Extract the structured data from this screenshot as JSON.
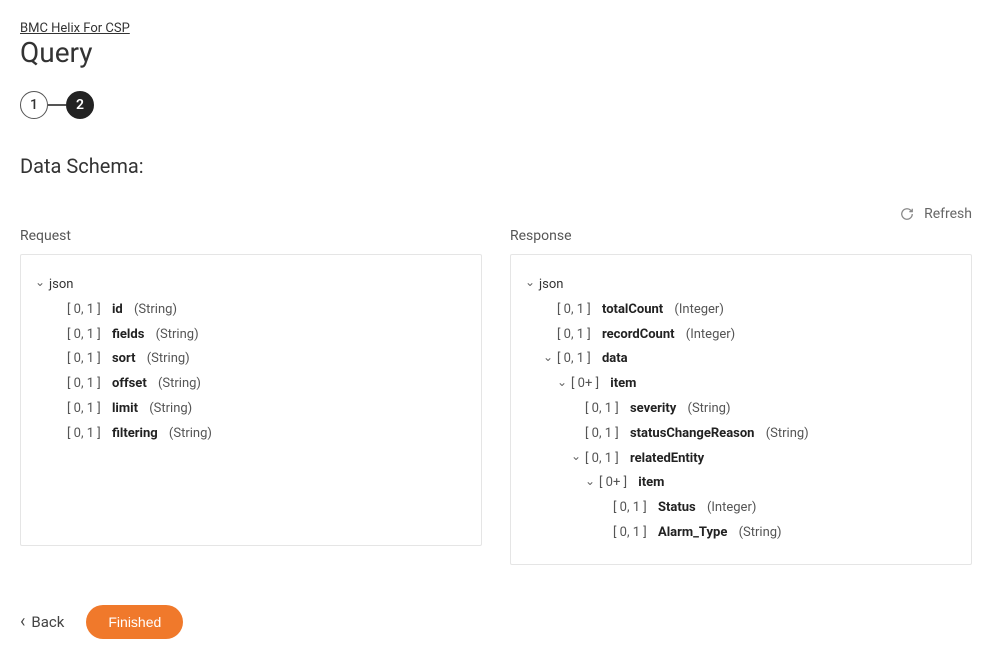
{
  "breadcrumb": "BMC Helix For CSP",
  "page_title": "Query",
  "stepper": {
    "steps": [
      "1",
      "2"
    ],
    "active_index": 1
  },
  "section_title": "Data Schema:",
  "refresh_label": "Refresh",
  "request": {
    "label": "Request",
    "root_label": "json",
    "items": [
      {
        "card": "[ 0, 1 ]",
        "name": "id",
        "type": "(String)"
      },
      {
        "card": "[ 0, 1 ]",
        "name": "fields",
        "type": "(String)"
      },
      {
        "card": "[ 0, 1 ]",
        "name": "sort",
        "type": "(String)"
      },
      {
        "card": "[ 0, 1 ]",
        "name": "offset",
        "type": "(String)"
      },
      {
        "card": "[ 0, 1 ]",
        "name": "limit",
        "type": "(String)"
      },
      {
        "card": "[ 0, 1 ]",
        "name": "filtering",
        "type": "(String)"
      }
    ]
  },
  "response": {
    "label": "Response",
    "root_label": "json",
    "top": [
      {
        "card": "[ 0, 1 ]",
        "name": "totalCount",
        "type": "(Integer)"
      },
      {
        "card": "[ 0, 1 ]",
        "name": "recordCount",
        "type": "(Integer)"
      }
    ],
    "data": {
      "card": "[ 0, 1 ]",
      "name": "data"
    },
    "data_item": {
      "card": "[ 0+ ]",
      "name": "item"
    },
    "data_item_fields": [
      {
        "card": "[ 0, 1 ]",
        "name": "severity",
        "type": "(String)"
      },
      {
        "card": "[ 0, 1 ]",
        "name": "statusChangeReason",
        "type": "(String)"
      }
    ],
    "related": {
      "card": "[ 0, 1 ]",
      "name": "relatedEntity"
    },
    "related_item": {
      "card": "[ 0+ ]",
      "name": "item"
    },
    "related_item_fields": [
      {
        "card": "[ 0, 1 ]",
        "name": "Status",
        "type": "(Integer)"
      },
      {
        "card": "[ 0, 1 ]",
        "name": "Alarm_Type",
        "type": "(String)"
      }
    ]
  },
  "footer": {
    "back": "Back",
    "finished": "Finished"
  }
}
